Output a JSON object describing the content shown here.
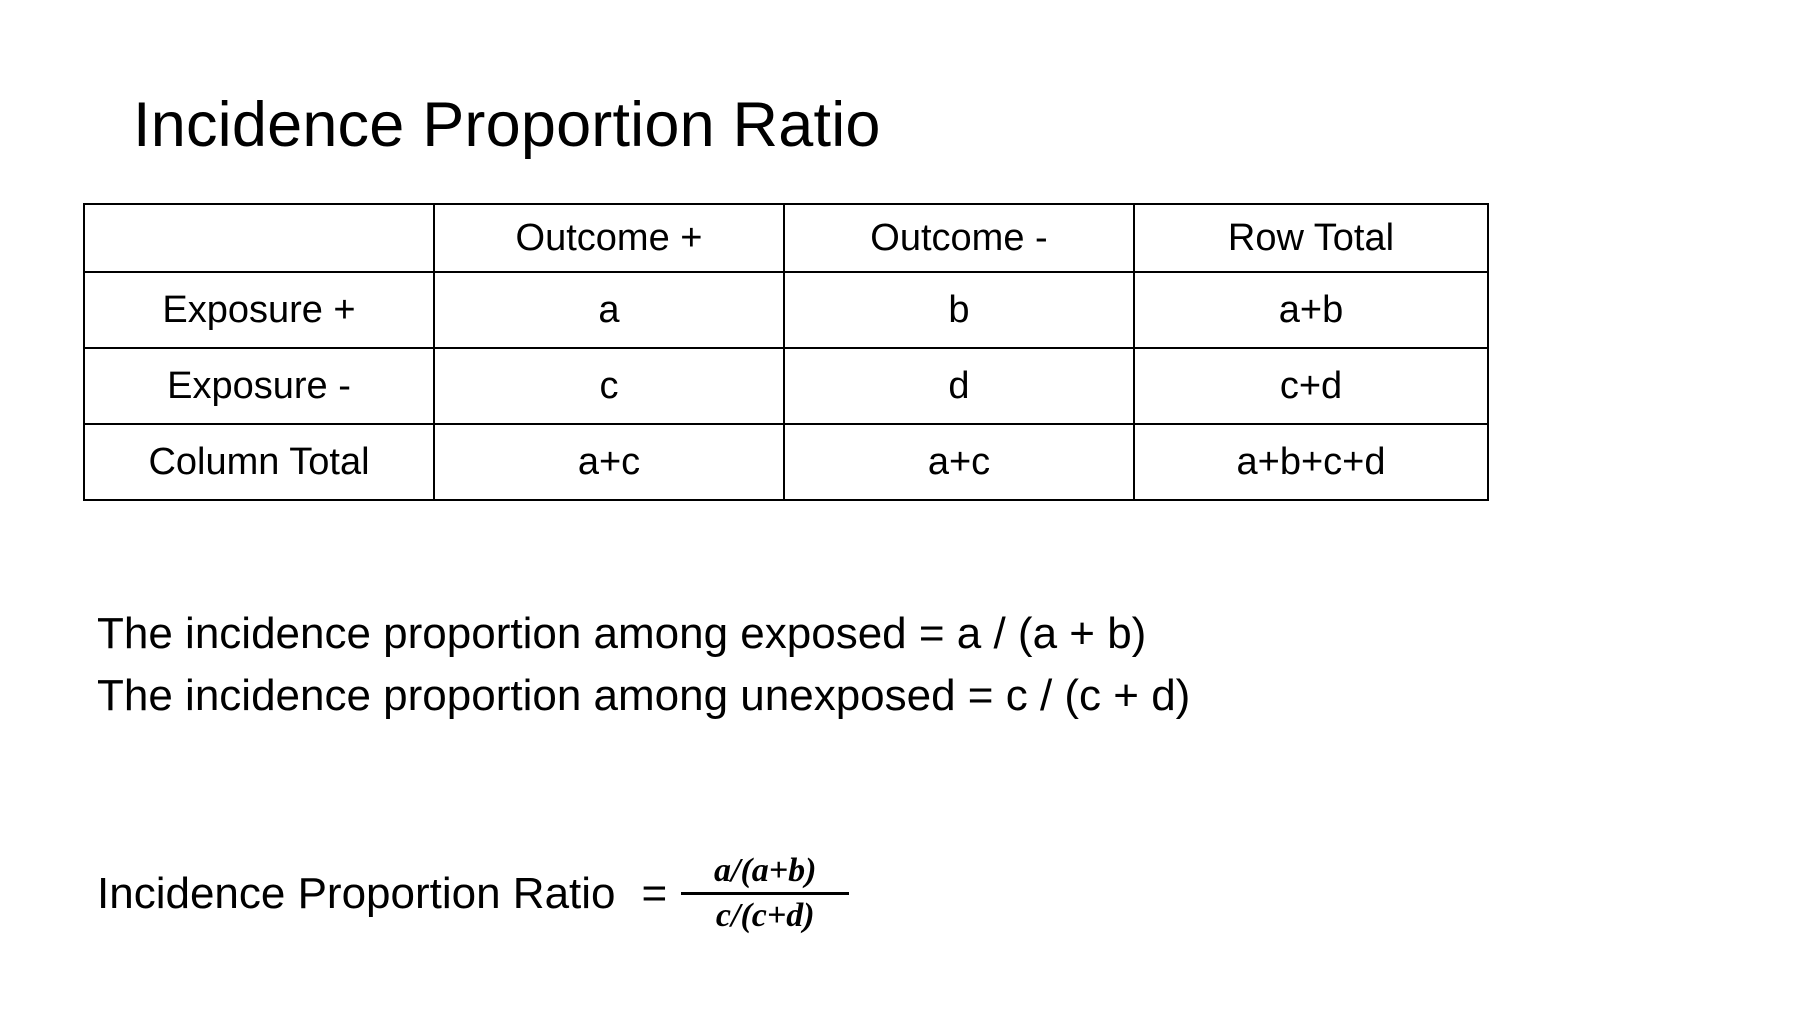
{
  "slide": {
    "title": "Incidence Proportion Ratio",
    "background_color": "#ffffff",
    "text_color": "#000000"
  },
  "colors": {
    "orange": "#b05c3c",
    "blue": "#4c718a",
    "green": "#52705e",
    "white": "#ffffff",
    "border": "#000000"
  },
  "table": {
    "corner_label": "",
    "column_headers": [
      "Outcome +",
      "Outcome -",
      "Row Total"
    ],
    "rows": [
      {
        "label": "Exposure +",
        "cells": [
          "a",
          "b",
          "a+b"
        ]
      },
      {
        "label": "Exposure -",
        "cells": [
          "c",
          "d",
          "c+d"
        ]
      },
      {
        "label": "Column Total",
        "cells": [
          "a+c",
          "a+c",
          "a+b+c+d"
        ]
      }
    ]
  },
  "notes": {
    "line1": "The incidence proportion among exposed = a / (a + b)",
    "line2": "The incidence proportion among unexposed = c / (c + d)"
  },
  "formula": {
    "label": "Incidence Proportion Ratio",
    "equals": "=",
    "numerator": "a/(a+b)",
    "denominator": "c/(c+d)"
  }
}
